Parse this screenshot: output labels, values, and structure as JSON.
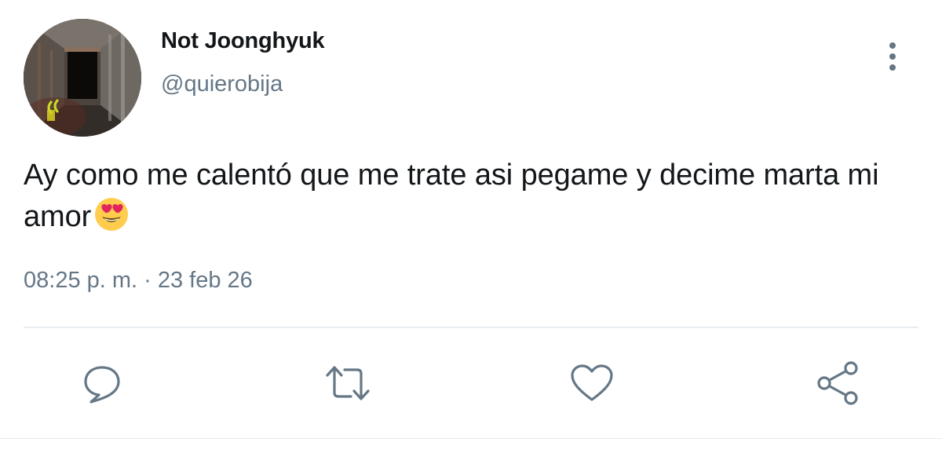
{
  "user": {
    "display_name": "Not Joonghyuk",
    "handle": "@quierobija",
    "avatar": "dark-hallway-photo"
  },
  "tweet": {
    "text": "Ay como me calentó que me trate asi pegame y decime marta mi amor",
    "emoji": "smiling-face-with-heart-eyes",
    "timestamp": "08:25 p. m. · 23 feb 26"
  },
  "actions": [
    {
      "name": "reply",
      "icon": "speech-bubble-icon"
    },
    {
      "name": "retweet",
      "icon": "retweet-arrows-icon"
    },
    {
      "name": "like",
      "icon": "heart-icon"
    },
    {
      "name": "share",
      "icon": "share-nodes-icon"
    }
  ],
  "colors": {
    "text": "#14171a",
    "secondary": "#657786",
    "divider": "#e6ecf0",
    "emoji_face": "#ffcc4d",
    "emoji_hearts": "#e0245e"
  }
}
